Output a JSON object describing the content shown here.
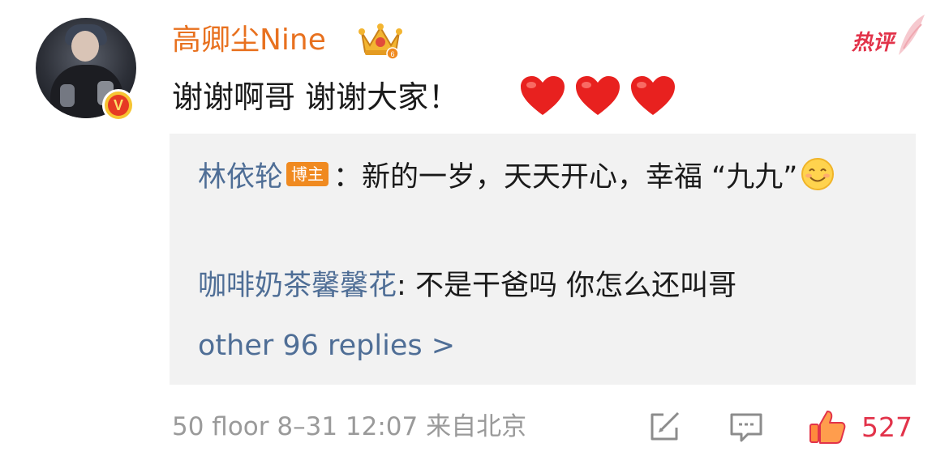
{
  "comment": {
    "username": "高卿尘Nine",
    "hot_label": "热评",
    "text": "谢谢啊哥 谢谢大家！",
    "emoji": [
      "heart-icon",
      "heart-icon",
      "heart-icon"
    ],
    "verified_badge": "V"
  },
  "replies": [
    {
      "name": "林依轮",
      "tag": "博主",
      "separator": "：",
      "text": "新的一岁，天天开心，幸福 “九九”",
      "emoji": "smile-icon"
    },
    {
      "name": "咖啡奶茶馨馨花",
      "separator": ": ",
      "text": "不是干爸吗  你怎么还叫哥"
    }
  ],
  "more_replies": "other 96 replies >",
  "meta": {
    "floor": "50 floor",
    "datetime": "8–31 12:07",
    "location": "来自北京"
  },
  "actions": {
    "repost_icon": "repost-icon",
    "comment_icon": "comment-icon",
    "like_icon": "thumbs-up-icon",
    "like_count": "527"
  },
  "colors": {
    "username": "#e8711f",
    "link": "#4f6e96",
    "hot": "#e2334a",
    "like": "#e2334a",
    "reply_bg": "#f2f2f2",
    "meta": "#9a9a9a"
  }
}
